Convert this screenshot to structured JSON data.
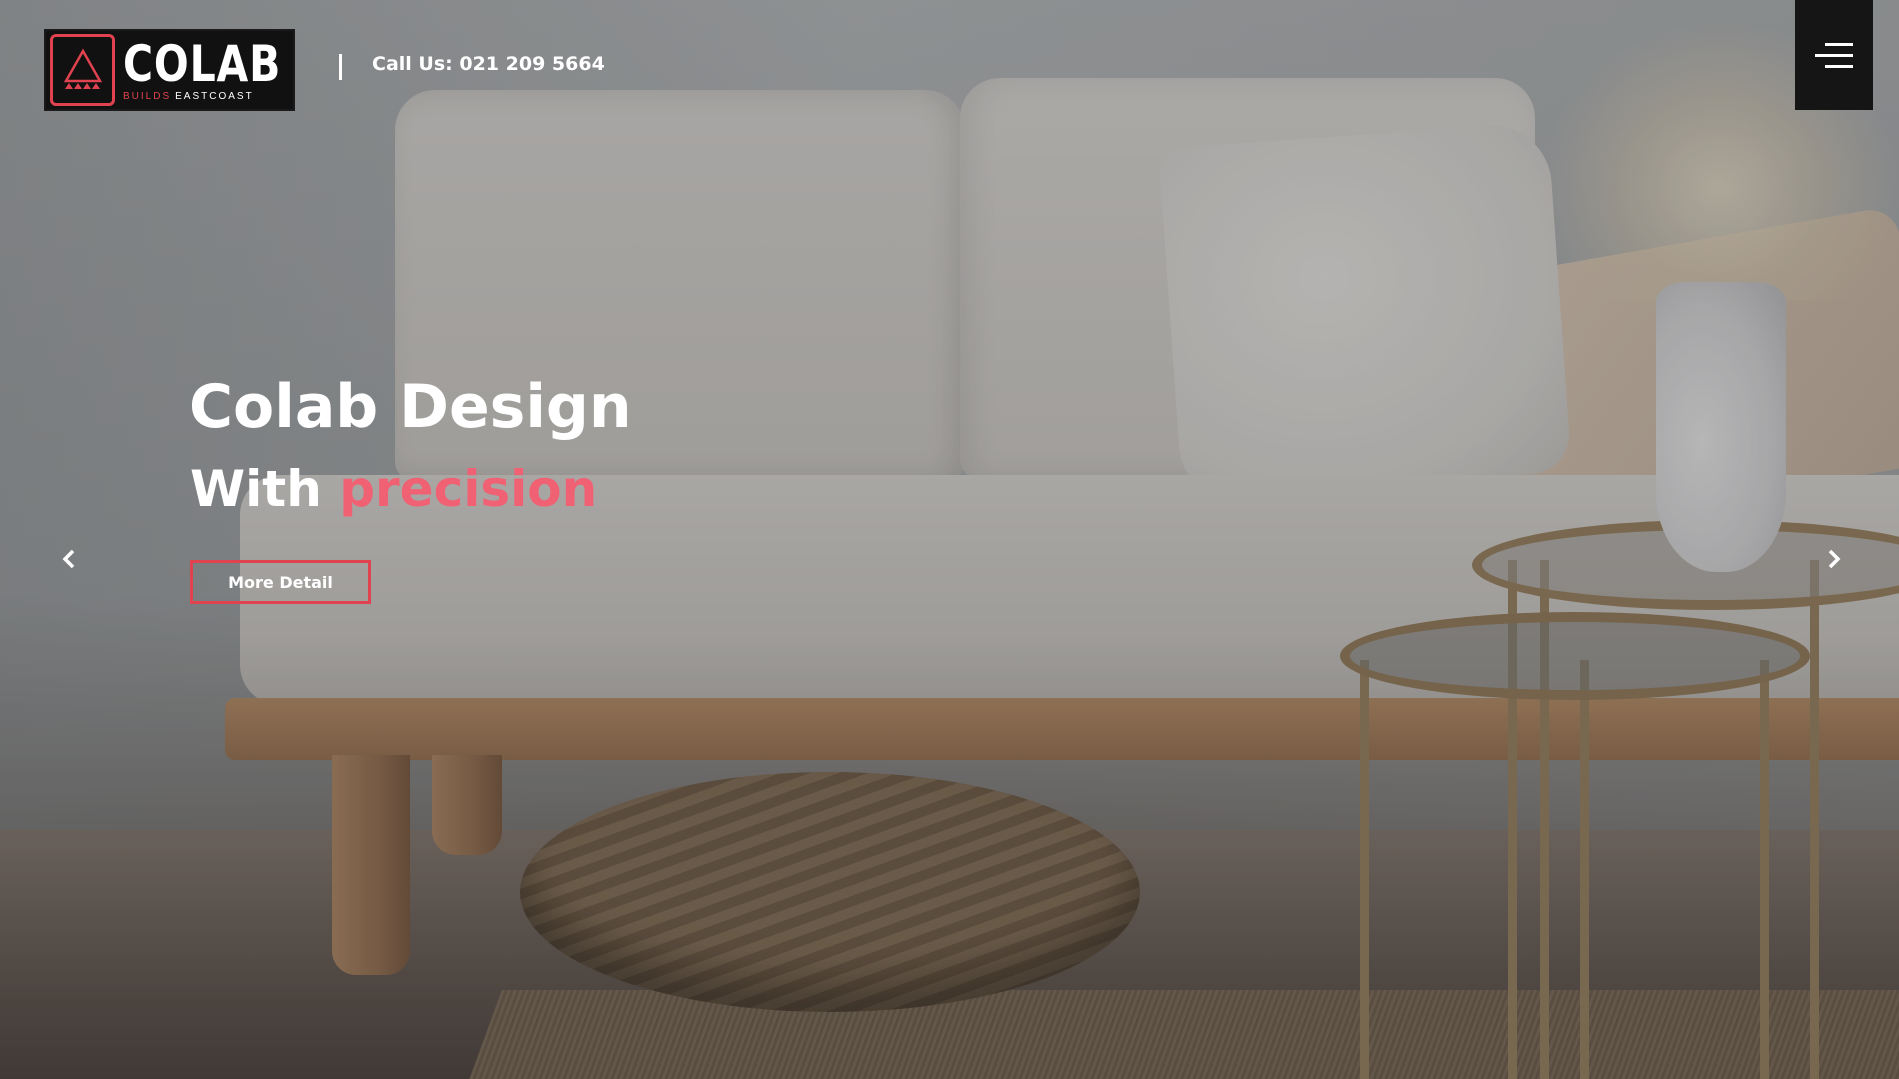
{
  "header": {
    "logo": {
      "word": "COLAB",
      "sub_builds": "BUILDS",
      "sub_east": "EASTCOAST"
    },
    "phone_label": "Call Us: 021 209 5664",
    "menu_icon": "hamburger-menu-icon"
  },
  "hero": {
    "title_line1": "Colab Design",
    "title_line2_prefix": "With",
    "title_line2_accent": "precision",
    "cta_label": "More Detail",
    "prev_icon": "chevron-left-icon",
    "next_icon": "chevron-right-icon"
  },
  "colors": {
    "accent": "#e0434f",
    "accent_text": "#f06173",
    "dark": "#151515",
    "text": "#ffffff"
  }
}
